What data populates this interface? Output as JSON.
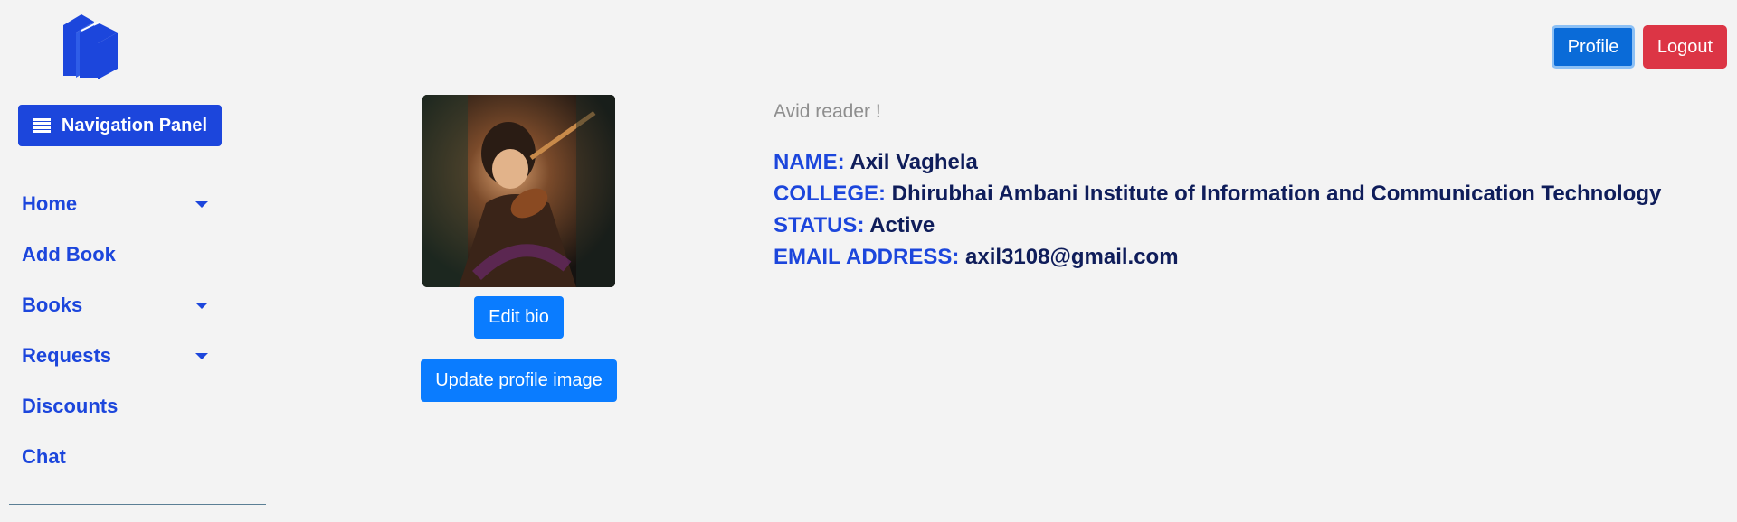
{
  "logo": {
    "icon": "books-icon"
  },
  "sidebar": {
    "panel_button": {
      "label": "Navigation Panel",
      "icon": "menu-icon"
    },
    "items": [
      {
        "label": "Home",
        "has_dropdown": true
      },
      {
        "label": "Add Book",
        "has_dropdown": false
      },
      {
        "label": "Books",
        "has_dropdown": true
      },
      {
        "label": "Requests",
        "has_dropdown": true
      },
      {
        "label": "Discounts",
        "has_dropdown": false
      },
      {
        "label": "Chat",
        "has_dropdown": false
      }
    ]
  },
  "header": {
    "profile_label": "Profile",
    "logout_label": "Logout"
  },
  "profile": {
    "edit_bio_label": "Edit bio",
    "update_image_label": "Update profile image",
    "bio": "Avid reader !",
    "fields": {
      "name_label": "NAME:",
      "name": "Axil Vaghela",
      "college_label": "COLLEGE:",
      "college": "Dhirubhai Ambani Institute of Information and Communication Technology",
      "status_label": "STATUS:",
      "status": "Active",
      "email_label": "EMAIL ADDRESS:",
      "email": "axil3108@gmail.com"
    }
  },
  "colors": {
    "brand": "#1c46dc",
    "primary": "#0a7cff",
    "danger": "#dc3545",
    "background": "#f3f3f3"
  }
}
